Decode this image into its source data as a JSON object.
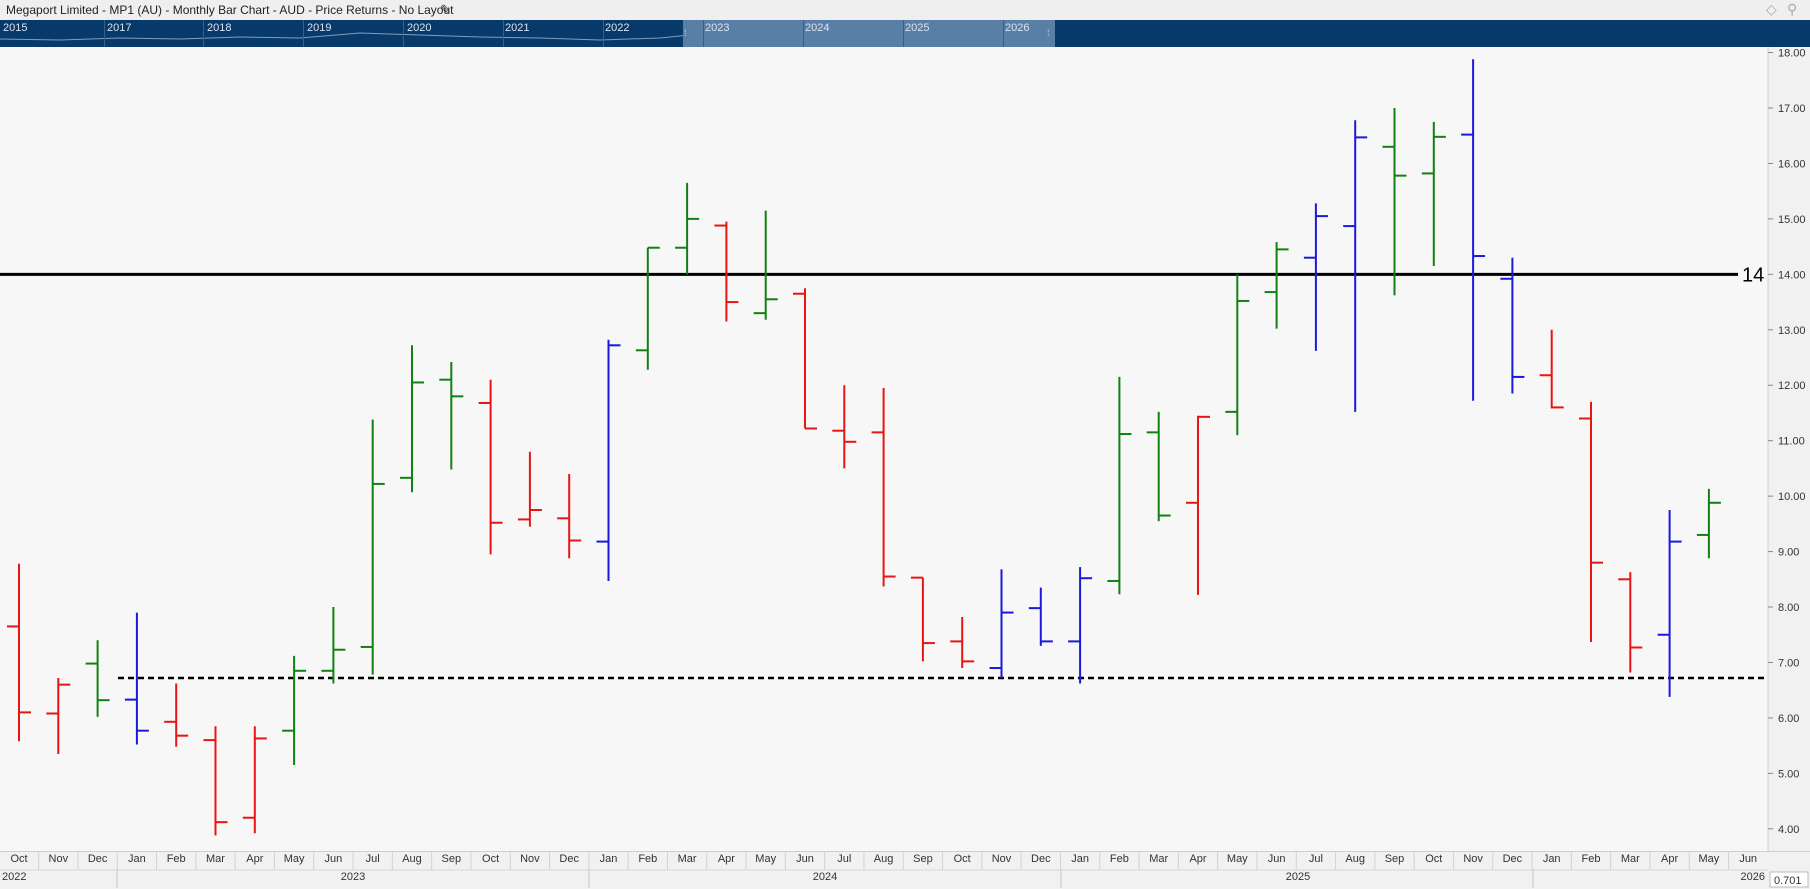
{
  "window": {
    "title": "Megaport Limited - MP1 (AU) - Monthly Bar Chart - AUD - Price Returns - No Layout"
  },
  "navigator": {
    "years": [
      "2015",
      "2017",
      "2018",
      "2019",
      "2020",
      "2021",
      "2022",
      "2023",
      "2024",
      "2025",
      "2026"
    ]
  },
  "chart_data": {
    "type": "ohlc-bar",
    "ylim": [
      3.6,
      18.1
    ],
    "yticks": [
      "4.00",
      "5.00",
      "6.00",
      "7.00",
      "8.00",
      "9.00",
      "10.00",
      "11.00",
      "12.00",
      "13.00",
      "14.00",
      "15.00",
      "16.00",
      "17.00",
      "18.00"
    ],
    "month_labels": [
      "Oct",
      "Nov",
      "Dec",
      "Jan",
      "Feb",
      "Mar",
      "Apr",
      "May",
      "Jun",
      "Jul",
      "Aug",
      "Sep",
      "Oct",
      "Nov",
      "Dec",
      "Jan",
      "Feb",
      "Mar",
      "Apr",
      "May",
      "Jun",
      "Jul",
      "Aug",
      "Sep",
      "Oct",
      "Nov",
      "Dec",
      "Jan",
      "Feb",
      "Mar",
      "Apr",
      "May",
      "Jun",
      "Jul",
      "Aug",
      "Sep",
      "Oct",
      "Nov",
      "Dec",
      "Jan",
      "Feb",
      "Mar",
      "Apr",
      "May",
      "Jun"
    ],
    "year_labels": [
      "2022",
      "2023",
      "2024",
      "2025",
      "2026"
    ],
    "colors": {
      "up": "#128012",
      "down": "#e81515",
      "neutral": "#1a1adb"
    },
    "bars": [
      {
        "open": 7.65,
        "high": 8.78,
        "low": 5.58,
        "close": 6.1,
        "dir": "down"
      },
      {
        "open": 6.08,
        "high": 6.72,
        "low": 5.35,
        "close": 6.6,
        "dir": "down"
      },
      {
        "open": 6.98,
        "high": 7.4,
        "low": 6.02,
        "close": 6.32,
        "dir": "up"
      },
      {
        "open": 6.33,
        "high": 7.9,
        "low": 5.52,
        "close": 5.77,
        "dir": "neutral"
      },
      {
        "open": 5.93,
        "high": 6.62,
        "low": 5.48,
        "close": 5.68,
        "dir": "down"
      },
      {
        "open": 5.6,
        "high": 5.85,
        "low": 3.88,
        "close": 4.12,
        "dir": "down"
      },
      {
        "open": 4.2,
        "high": 5.85,
        "low": 3.92,
        "close": 5.63,
        "dir": "down"
      },
      {
        "open": 5.77,
        "high": 7.12,
        "low": 5.15,
        "close": 6.85,
        "dir": "up"
      },
      {
        "open": 6.85,
        "high": 8.0,
        "low": 6.62,
        "close": 7.23,
        "dir": "up"
      },
      {
        "open": 7.28,
        "high": 11.38,
        "low": 6.78,
        "close": 10.22,
        "dir": "up"
      },
      {
        "open": 10.33,
        "high": 12.72,
        "low": 10.07,
        "close": 12.05,
        "dir": "up"
      },
      {
        "open": 12.1,
        "high": 12.42,
        "low": 10.48,
        "close": 11.8,
        "dir": "up"
      },
      {
        "open": 11.68,
        "high": 12.1,
        "low": 8.95,
        "close": 9.52,
        "dir": "down"
      },
      {
        "open": 9.58,
        "high": 10.8,
        "low": 9.45,
        "close": 9.75,
        "dir": "down"
      },
      {
        "open": 9.6,
        "high": 10.4,
        "low": 8.88,
        "close": 9.2,
        "dir": "down"
      },
      {
        "open": 9.18,
        "high": 12.82,
        "low": 8.47,
        "close": 12.72,
        "dir": "neutral"
      },
      {
        "open": 12.63,
        "high": 14.48,
        "low": 12.28,
        "close": 14.48,
        "dir": "up"
      },
      {
        "open": 14.48,
        "high": 15.65,
        "low": 14.0,
        "close": 15.0,
        "dir": "up"
      },
      {
        "open": 14.88,
        "high": 14.95,
        "low": 13.15,
        "close": 13.5,
        "dir": "down"
      },
      {
        "open": 13.3,
        "high": 15.15,
        "low": 13.18,
        "close": 13.55,
        "dir": "up"
      },
      {
        "open": 13.65,
        "high": 13.75,
        "low": 11.22,
        "close": 11.22,
        "dir": "down"
      },
      {
        "open": 11.18,
        "high": 12.0,
        "low": 10.5,
        "close": 10.98,
        "dir": "down"
      },
      {
        "open": 11.15,
        "high": 11.95,
        "low": 8.37,
        "close": 8.55,
        "dir": "down"
      },
      {
        "open": 8.53,
        "high": 8.53,
        "low": 7.02,
        "close": 7.35,
        "dir": "down"
      },
      {
        "open": 7.38,
        "high": 7.82,
        "low": 6.9,
        "close": 7.02,
        "dir": "down"
      },
      {
        "open": 6.9,
        "high": 8.68,
        "low": 6.72,
        "close": 7.9,
        "dir": "neutral"
      },
      {
        "open": 7.98,
        "high": 8.35,
        "low": 7.3,
        "close": 7.38,
        "dir": "neutral"
      },
      {
        "open": 7.38,
        "high": 8.72,
        "low": 6.62,
        "close": 8.52,
        "dir": "neutral"
      },
      {
        "open": 8.47,
        "high": 12.15,
        "low": 8.23,
        "close": 11.12,
        "dir": "up"
      },
      {
        "open": 11.15,
        "high": 11.52,
        "low": 9.55,
        "close": 9.65,
        "dir": "up"
      },
      {
        "open": 9.88,
        "high": 11.45,
        "low": 8.22,
        "close": 11.43,
        "dir": "down"
      },
      {
        "open": 11.52,
        "high": 14.0,
        "low": 11.1,
        "close": 13.52,
        "dir": "up"
      },
      {
        "open": 13.68,
        "high": 14.58,
        "low": 13.02,
        "close": 14.45,
        "dir": "up"
      },
      {
        "open": 14.3,
        "high": 15.28,
        "low": 12.62,
        "close": 15.05,
        "dir": "neutral"
      },
      {
        "open": 14.87,
        "high": 16.78,
        "low": 11.52,
        "close": 16.47,
        "dir": "neutral"
      },
      {
        "open": 16.3,
        "high": 17.0,
        "low": 13.62,
        "close": 15.78,
        "dir": "up"
      },
      {
        "open": 15.82,
        "high": 16.75,
        "low": 14.15,
        "close": 16.48,
        "dir": "up"
      },
      {
        "open": 16.52,
        "high": 17.88,
        "low": 11.72,
        "close": 14.33,
        "dir": "neutral"
      },
      {
        "open": 13.92,
        "high": 14.3,
        "low": 11.85,
        "close": 12.15,
        "dir": "neutral"
      },
      {
        "open": 12.18,
        "high": 13.0,
        "low": 11.58,
        "close": 11.6,
        "dir": "down"
      },
      {
        "open": 11.4,
        "high": 11.7,
        "low": 7.37,
        "close": 8.8,
        "dir": "down"
      },
      {
        "open": 8.5,
        "high": 8.63,
        "low": 6.82,
        "close": 7.27,
        "dir": "down"
      },
      {
        "open": 7.5,
        "high": 9.75,
        "low": 6.38,
        "close": 9.18,
        "dir": "neutral"
      },
      {
        "open": 9.3,
        "high": 10.13,
        "low": 8.88,
        "close": 9.88,
        "dir": "up"
      }
    ],
    "horizontal_lines": [
      {
        "value": 14.0,
        "style": "solid",
        "label": "14"
      },
      {
        "value": 6.72,
        "style": "dashed",
        "label": ""
      }
    ],
    "corner_value": "0.701"
  }
}
